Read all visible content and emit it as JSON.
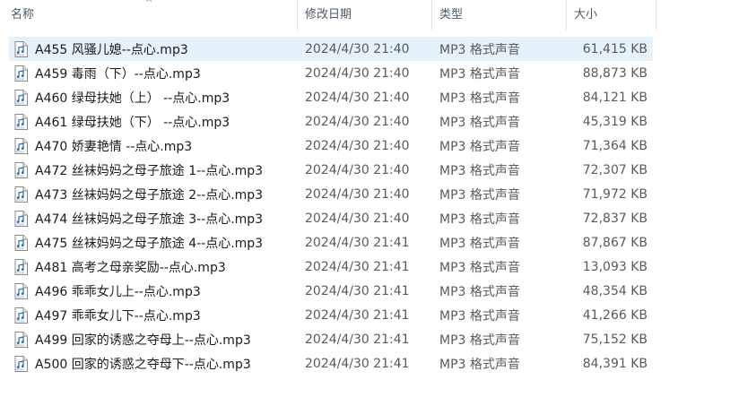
{
  "columns": {
    "name": "名称",
    "date": "修改日期",
    "type": "类型",
    "size": "大小"
  },
  "sort_indicator": "^",
  "files": [
    {
      "name": "A455 风骚儿媳--点心.mp3",
      "date": "2024/4/30 21:40",
      "type": "MP3 格式声音",
      "size": "61,415 KB",
      "icon": "audio-file-icon"
    },
    {
      "name": "A459 毒雨（下）--点心.mp3",
      "date": "2024/4/30 21:40",
      "type": "MP3 格式声音",
      "size": "88,873 KB",
      "icon": "audio-file-icon"
    },
    {
      "name": "A460 绿母扶她（上） --点心.mp3",
      "date": "2024/4/30 21:40",
      "type": "MP3 格式声音",
      "size": "84,121 KB",
      "icon": "audio-file-icon"
    },
    {
      "name": "A461 绿母扶她（下） --点心.mp3",
      "date": "2024/4/30 21:40",
      "type": "MP3 格式声音",
      "size": "45,319 KB",
      "icon": "audio-file-icon"
    },
    {
      "name": "A470 娇妻艳情 --点心.mp3",
      "date": "2024/4/30 21:40",
      "type": "MP3 格式声音",
      "size": "71,364 KB",
      "icon": "audio-file-icon"
    },
    {
      "name": "A472 丝袜妈妈之母子旅途 1--点心.mp3",
      "date": "2024/4/30 21:40",
      "type": "MP3 格式声音",
      "size": "72,307 KB",
      "icon": "audio-file-icon"
    },
    {
      "name": "A473 丝袜妈妈之母子旅途 2--点心.mp3",
      "date": "2024/4/30 21:40",
      "type": "MP3 格式声音",
      "size": "71,972 KB",
      "icon": "audio-file-icon"
    },
    {
      "name": "A474 丝袜妈妈之母子旅途 3--点心.mp3",
      "date": "2024/4/30 21:40",
      "type": "MP3 格式声音",
      "size": "72,837 KB",
      "icon": "audio-file-icon"
    },
    {
      "name": "A475 丝袜妈妈之母子旅途 4--点心.mp3",
      "date": "2024/4/30 21:41",
      "type": "MP3 格式声音",
      "size": "87,867 KB",
      "icon": "audio-file-icon"
    },
    {
      "name": "A481 高考之母亲奖励--点心.mp3",
      "date": "2024/4/30 21:41",
      "type": "MP3 格式声音",
      "size": "13,093 KB",
      "icon": "audio-file-icon"
    },
    {
      "name": "A496 乖乖女儿上--点心.mp3",
      "date": "2024/4/30 21:41",
      "type": "MP3 格式声音",
      "size": "48,354 KB",
      "icon": "audio-file-icon"
    },
    {
      "name": "A497 乖乖女儿下--点心.mp3",
      "date": "2024/4/30 21:41",
      "type": "MP3 格式声音",
      "size": "41,266 KB",
      "icon": "audio-file-icon"
    },
    {
      "name": "A499 回家的诱惑之夺母上--点心.mp3",
      "date": "2024/4/30 21:41",
      "type": "MP3 格式声音",
      "size": "75,152 KB",
      "icon": "audio-file-icon"
    },
    {
      "name": "A500 回家的诱惑之夺母下--点心.mp3",
      "date": "2024/4/30 21:41",
      "type": "MP3 格式声音",
      "size": "84,391 KB",
      "icon": "audio-file-icon"
    }
  ],
  "colors": {
    "selected_row": "#e5f1fb",
    "header_text": "#4a5a6a",
    "icon_accent": "#2b6cb0"
  }
}
